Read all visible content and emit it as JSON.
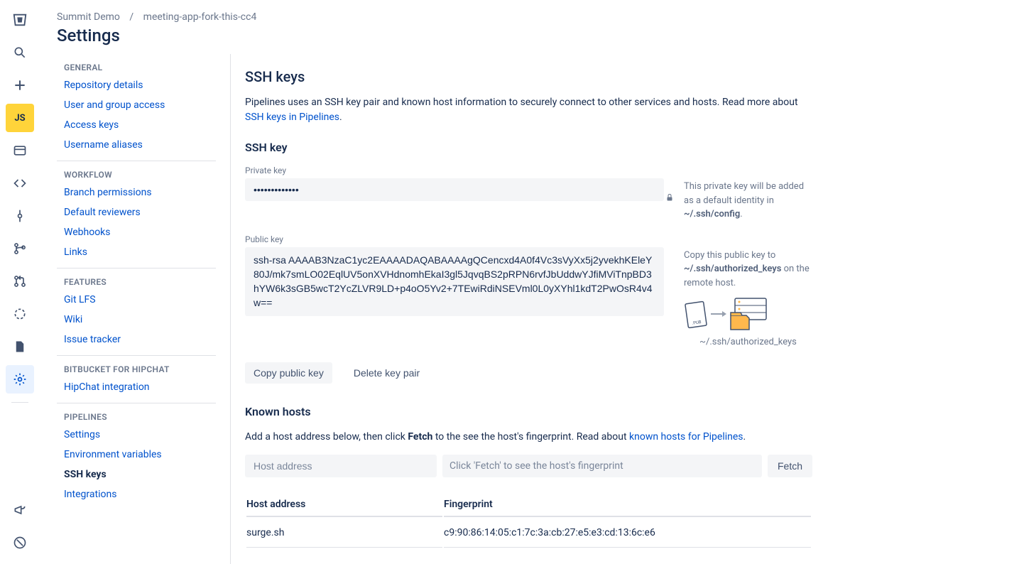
{
  "breadcrumb": {
    "project": "Summit Demo",
    "repo": "meeting-app-fork-this-cc4"
  },
  "page_title": "Settings",
  "rail_avatar": "JS",
  "nav": {
    "general": {
      "header": "GENERAL",
      "items": [
        "Repository details",
        "User and group access",
        "Access keys",
        "Username aliases"
      ]
    },
    "workflow": {
      "header": "WORKFLOW",
      "items": [
        "Branch permissions",
        "Default reviewers",
        "Webhooks",
        "Links"
      ]
    },
    "features": {
      "header": "FEATURES",
      "items": [
        "Git LFS",
        "Wiki",
        "Issue tracker"
      ]
    },
    "hipchat": {
      "header": "BITBUCKET FOR HIPCHAT",
      "items": [
        "HipChat integration"
      ]
    },
    "pipelines": {
      "header": "PIPELINES",
      "items": [
        "Settings",
        "Environment variables",
        "SSH keys",
        "Integrations"
      ],
      "active_index": 2
    }
  },
  "ssh": {
    "title": "SSH keys",
    "lead_pre": "Pipelines uses an SSH key pair and known host information to securely connect to other services and hosts. Read more about ",
    "lead_link": "SSH keys in Pipelines",
    "section_title": "SSH key",
    "private_label": "Private key",
    "private_value": "•••••••••••••",
    "private_help_pre": "This private key will be added as a default identity in ",
    "private_help_path": "~/.ssh/config",
    "public_label": "Public key",
    "public_value": "ssh-rsa AAAAB3NzaC1yc2EAAAADAQABAAAAgQCencxd4A0f4Vc3sVyXx5j2yvekhKEleY80J/mk7smLO02EqlUV5onXVHdnomhEkaI3gl5JqvqBS2pRPN6rvfJbUddwYJfiMViTnpBD3hYW6k3sGB5wcT2YcZLVR9LD+p4oO5Yv2+7TEwiRdiNSEVml0L0yXYhl1kdT2PwOsR4v4w==",
    "public_help_pre": "Copy this public key to ",
    "public_help_path": "~/.ssh/authorized_keys",
    "public_help_post": " on the remote host.",
    "diag_caption": "~/.ssh/authorized_keys",
    "copy_btn": "Copy public key",
    "delete_btn": "Delete key pair"
  },
  "known_hosts": {
    "title": "Known hosts",
    "desc_pre": "Add a host address below, then click ",
    "desc_bold": "Fetch",
    "desc_mid": " to the see the host's fingerprint. Read about ",
    "desc_link": "known hosts for Pipelines",
    "host_placeholder": "Host address",
    "fingerprint_placeholder": "Click 'Fetch' to see the host's fingerprint",
    "fetch_btn": "Fetch",
    "col_host": "Host address",
    "col_fingerprint": "Fingerprint",
    "rows": [
      {
        "host": "surge.sh",
        "fingerprint": "c9:90:86:14:05:c1:7c:3a:cb:27:e5:e3:cd:13:6c:e6"
      }
    ]
  }
}
